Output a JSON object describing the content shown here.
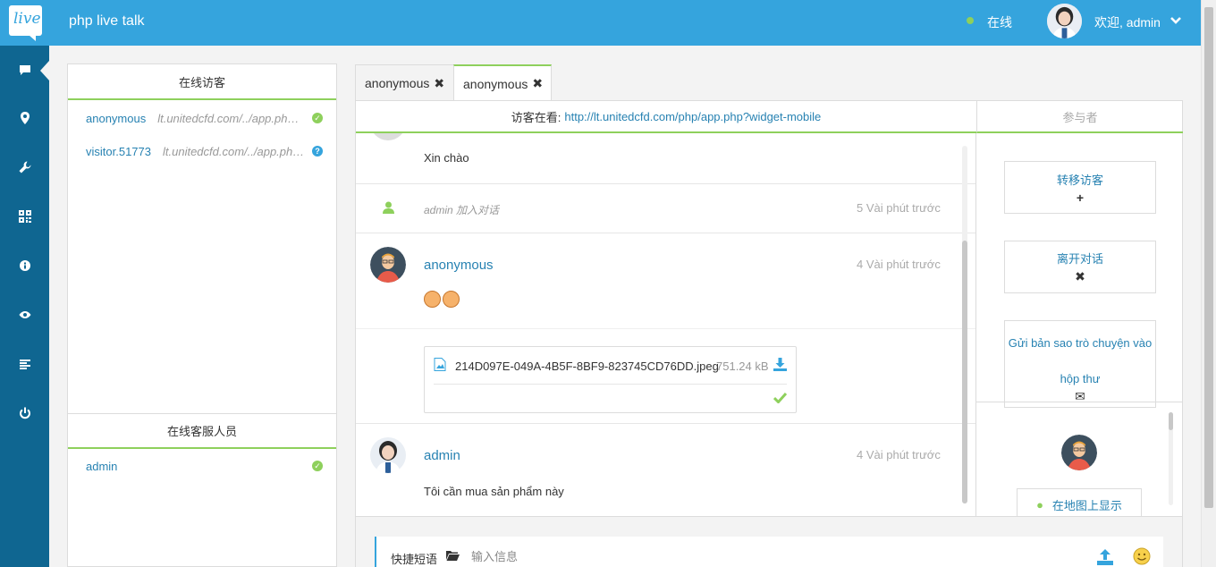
{
  "header": {
    "logo_text": "live",
    "app_title": "php live talk",
    "status": "在线",
    "welcome": "欢迎, admin"
  },
  "visitors": {
    "title": "在线访客",
    "rows": [
      {
        "name": "anonymous",
        "url": "lt.unitedcfd.com/../app.php?widget-mobile",
        "status": "online"
      },
      {
        "name": "visitor.51773",
        "url": "lt.unitedcfd.com/../app.php?widget-mobile",
        "status": "unknown"
      }
    ],
    "staff_title": "在线客服人员",
    "staff": [
      {
        "name": "admin",
        "status": "online"
      }
    ]
  },
  "tabs": [
    {
      "label": "anonymous",
      "close": "✖"
    },
    {
      "label": "anonymous",
      "close": "✖"
    }
  ],
  "chat": {
    "viewing_label": "访客在看:",
    "viewing_url": "http://lt.unitedcfd.com/php/app.php?widget-mobile",
    "participants_label": "参与者",
    "messages": [
      {
        "text": "Xin chào"
      },
      {
        "system_text": "admin 加入对话",
        "time": "5 Vài phút trước"
      },
      {
        "author": "anonymous",
        "time": "4 Vài phút trước"
      },
      {
        "file_name": "214D097E-049A-4B5F-8BF9-823745CD76DD.jpeg",
        "file_size": "751.24 kB"
      },
      {
        "author": "admin",
        "time": "4 Vài phút trước",
        "text": "Tôi cần mua sản phẩm này"
      }
    ]
  },
  "side": {
    "transfer": "转移访客",
    "transfer_icon": "+",
    "leave": "离开对话",
    "leave_icon": "✖",
    "email_line1": "Gửi bản sao trò chuyện vào",
    "email_line2": "hộp thư",
    "email_icon": "✉",
    "map": "在地图上显示"
  },
  "input": {
    "quick_label": "快捷短语",
    "placeholder": "输入信息"
  },
  "colors": {
    "header_blue": "#35a4dd",
    "nav_blue": "#0f6691",
    "accent_green": "#8ed05c",
    "link_blue": "#2782b2"
  }
}
